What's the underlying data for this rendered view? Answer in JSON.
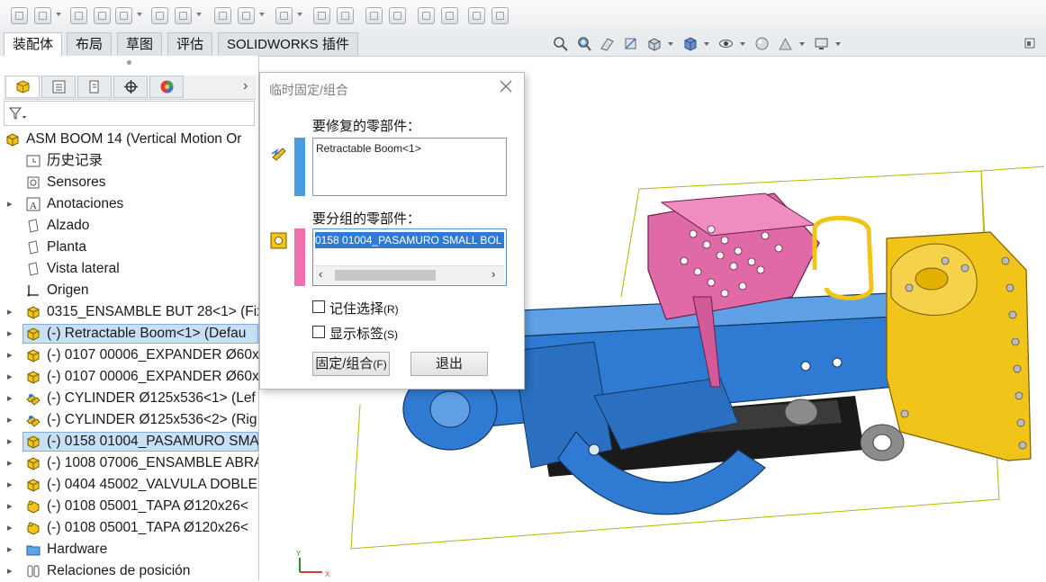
{
  "command_tabs": [
    "装配体",
    "布局",
    "草图",
    "评估",
    "SOLIDWORKS 插件"
  ],
  "active_tab_index": 0,
  "feature_tree": {
    "root": "ASM BOOM 14  (Vertical Motion Or",
    "items": [
      {
        "label": "历史记录",
        "icon": "history-icon",
        "expandable": false
      },
      {
        "label": "Sensores",
        "icon": "sensor-icon",
        "expandable": false
      },
      {
        "label": "Anotaciones",
        "icon": "annotation-icon",
        "expandable": true
      },
      {
        "label": "Alzado",
        "icon": "plane-icon",
        "expandable": false
      },
      {
        "label": "Planta",
        "icon": "plane-icon",
        "expandable": false
      },
      {
        "label": "Vista lateral",
        "icon": "plane-icon",
        "expandable": false
      },
      {
        "label": "Origen",
        "icon": "origin-icon",
        "expandable": false
      },
      {
        "label": "0315_ENSAMBLE BUT 28<1> (Fix",
        "icon": "subassembly-icon",
        "expandable": true
      },
      {
        "label": "(-) Retractable Boom<1> (Defau",
        "icon": "subassembly-icon",
        "expandable": true,
        "selected": true
      },
      {
        "label": "(-) 0107 00006_EXPANDER Ø60x",
        "icon": "subassembly-icon",
        "expandable": true
      },
      {
        "label": "(-) 0107 00006_EXPANDER Ø60x",
        "icon": "subassembly-icon",
        "expandable": true
      },
      {
        "label": "(-) CYLINDER Ø125x536<1> (Lef",
        "icon": "cylinder-assembly-icon",
        "expandable": true
      },
      {
        "label": "(-) CYLINDER Ø125x536<2> (Rig",
        "icon": "cylinder-assembly-icon",
        "expandable": true
      },
      {
        "label": "(-) 0158 01004_PASAMURO SMA",
        "icon": "subassembly-icon",
        "expandable": true,
        "selected": true
      },
      {
        "label": "(-) 1008 07006_ENSAMBLE ABRA",
        "icon": "subassembly-icon",
        "expandable": true
      },
      {
        "label": "(-) 0404 45002_VALVULA DOBLE",
        "icon": "subassembly-icon",
        "expandable": true
      },
      {
        "label": "(-) 0108 05001_TAPA Ø120x26<",
        "icon": "part-icon",
        "expandable": true
      },
      {
        "label": "(-) 0108 05001_TAPA Ø120x26<",
        "icon": "part-icon",
        "expandable": true
      },
      {
        "label": "Hardware",
        "icon": "folder-icon",
        "expandable": true
      },
      {
        "label": "Relaciones de posición",
        "icon": "mates-icon",
        "expandable": true
      }
    ]
  },
  "dialog": {
    "title": "临时固定/组合",
    "fix_label": "要修复的零部件：",
    "fix_items": [
      "Retractable Boom<1>"
    ],
    "group_label": "要分组的零部件：",
    "group_items": [
      "0158 01004_PASAMURO SMALL BOL"
    ],
    "remember_label": "记住选择",
    "remember_key": "(R)",
    "show_tags_label": "显示标签",
    "show_tags_key": "(S)",
    "fix_group_button": "固定/组合",
    "fix_group_key": "(F)",
    "exit_button": "退出",
    "fix_color": "#4a9be0",
    "group_color": "#f06fae"
  },
  "axis_triad": {
    "x": "X",
    "y": "Y"
  },
  "colors": {
    "boom_blue": "#2f7bd3",
    "bracket_yellow": "#f0c419",
    "guard_pink": "#e06aa8",
    "bbox": "#b8b400"
  }
}
